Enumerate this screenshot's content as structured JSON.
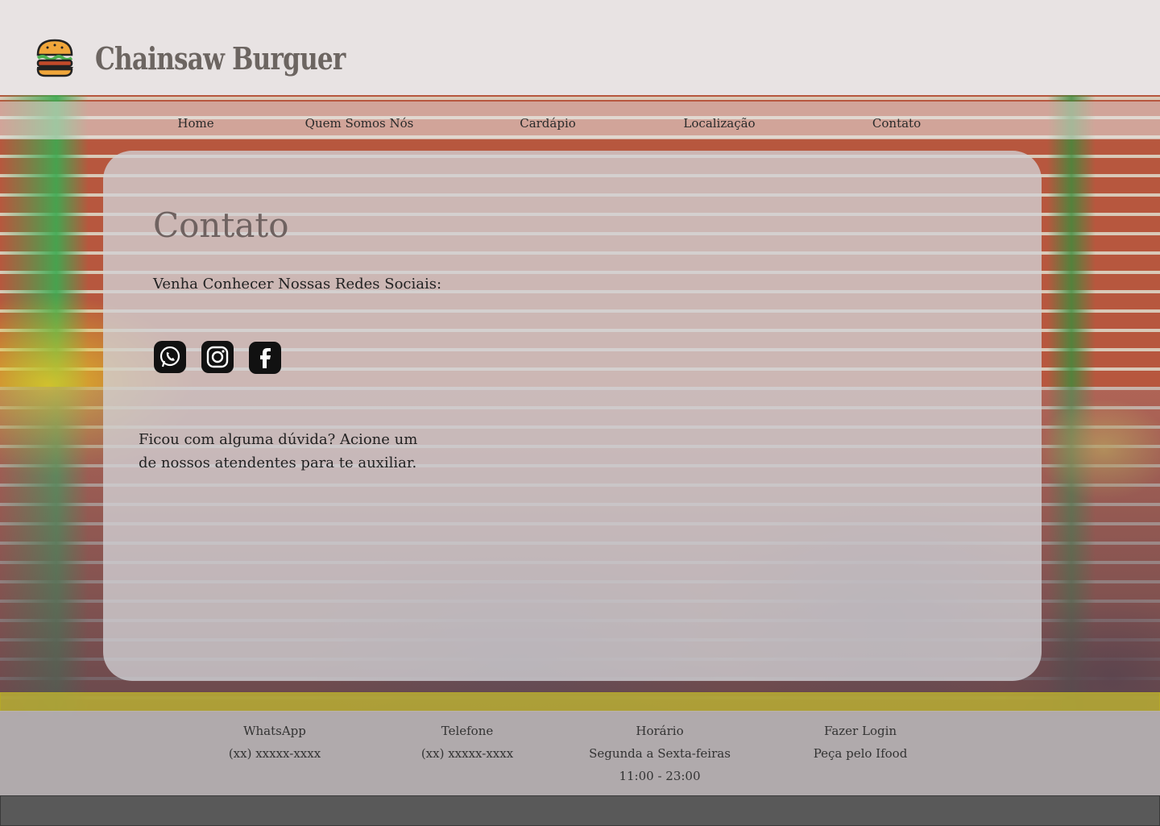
{
  "header": {
    "brand": "Chainsaw Burguer",
    "logo_icon": "burger-icon"
  },
  "nav": {
    "items": [
      {
        "label": "Home"
      },
      {
        "label": "Quem Somos Nós"
      },
      {
        "label": "Cardápio"
      },
      {
        "label": "Localização"
      },
      {
        "label": "Contato"
      }
    ]
  },
  "contact": {
    "title": "Contato",
    "subtitle": "Venha Conhecer Nossas Redes Sociais:",
    "social_icons": [
      "whatsapp-icon",
      "instagram-icon",
      "facebook-icon"
    ],
    "help_text": "Ficou com alguma dúvida? Acione um de nossos atendentes para te auxiliar."
  },
  "footer": {
    "whatsapp": {
      "label": "WhatsApp",
      "value": "(xx) xxxxx-xxxx"
    },
    "telefone": {
      "label": "Telefone",
      "value": "(xx) xxxxx-xxxx"
    },
    "horario": {
      "label": "Horário",
      "days": "Segunda a Sexta-feiras",
      "hours": "11:00 - 23:00"
    },
    "login": {
      "label": "Fazer Login",
      "ifood": "Peça pelo Ifood"
    }
  },
  "colors": {
    "header_bg": "#e8e3e3",
    "card_bg": "#d2d2d6",
    "stripe": "#beb432",
    "bottom_bar": "#595959"
  }
}
